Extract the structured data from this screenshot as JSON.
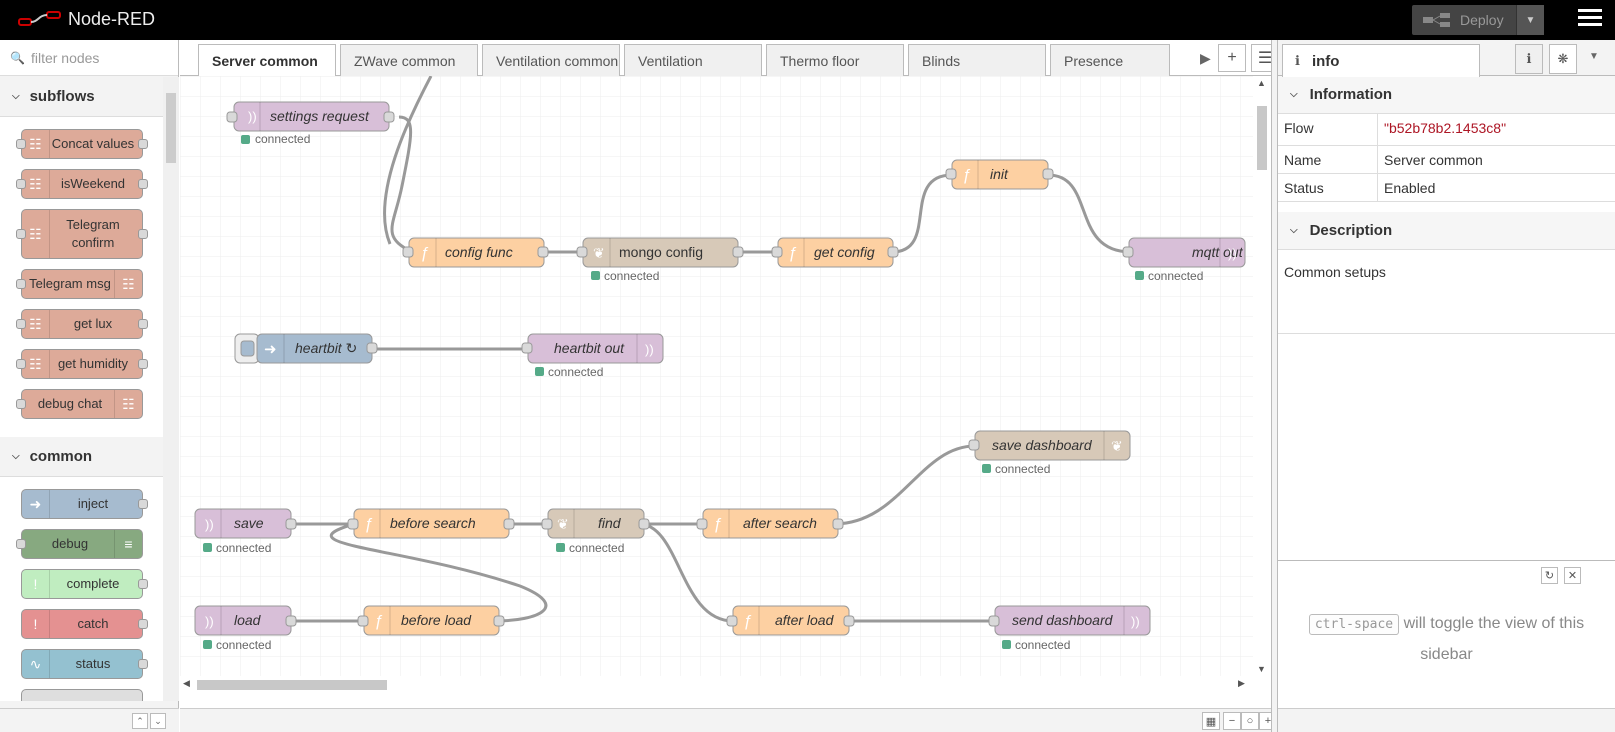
{
  "app": {
    "title": "Node-RED",
    "deploy_label": "Deploy"
  },
  "palette": {
    "filter_placeholder": "filter nodes",
    "categories": [
      {
        "name": "subflows",
        "nodes": [
          "Concat values",
          "isWeekend",
          "Telegram confirm",
          "Telegram msg",
          "get lux",
          "get humidity",
          "debug chat"
        ]
      },
      {
        "name": "common",
        "nodes": [
          "inject",
          "debug",
          "complete",
          "catch",
          "status"
        ]
      }
    ]
  },
  "workspace": {
    "tabs": [
      "Server common",
      "ZWave common",
      "Ventilation common",
      "Ventilation",
      "Thermo floor",
      "Blinds",
      "Presence"
    ],
    "active_tab": "Server common",
    "nodes": {
      "settings_request": "settings request",
      "config_func": "config func",
      "mongo_config": "mongo config",
      "get_config": "get config",
      "init": "init",
      "mqtt_out": "mqtt out",
      "heartbit": "heartbit ↻",
      "heartbit_out": "heartbit out",
      "save_dashboard": "save dashboard",
      "save": "save",
      "before_search": "before search",
      "find": "find",
      "after_search": "after search",
      "load": "load",
      "before_load": "before load",
      "after_load": "after load",
      "send_dashboard": "send dashboard"
    },
    "status_connected": "connected"
  },
  "sidebar": {
    "tab_label": "info",
    "info_section": "Information",
    "properties": [
      {
        "key": "Flow",
        "value": "\"b52b78b2.1453c8\""
      },
      {
        "key": "Name",
        "value": "Server common"
      },
      {
        "key": "Status",
        "value": "Enabled"
      }
    ],
    "description_section": "Description",
    "description": "Common setups",
    "tip": {
      "keys": "ctrl-space",
      "text": "will toggle the view of this sidebar"
    }
  },
  "colors": {
    "function": "#FDD0A2",
    "mqtt": "#D8BFD8",
    "mongo": "#D7C9B8",
    "subflow": "#DDAA99",
    "inject": "#A6BBCF",
    "debug": "#87A980",
    "complete": "#C0EDC0",
    "catch": "#E49191",
    "status": "#94C1D0",
    "connected": "#5a8"
  }
}
